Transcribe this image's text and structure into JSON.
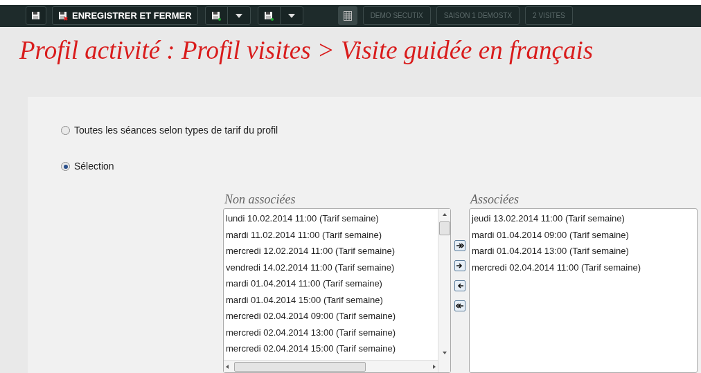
{
  "toolbar": {
    "save_close_label": "ENREGISTRER ET FERMER",
    "tabs": [
      {
        "label": "DEMO SECUTIX",
        "disabled": true
      },
      {
        "label": "SAISON 1 DEMOSTX",
        "disabled": true
      },
      {
        "label": "2 VISITES",
        "disabled": true
      }
    ]
  },
  "title": "Profil activité : Profil visites > Visite guidée en français",
  "options": [
    {
      "label": "Toutes les séances selon types de tarif du profil",
      "selected": false
    },
    {
      "label": "Sélection",
      "selected": true
    }
  ],
  "non_associees": {
    "label": "Non associées",
    "items": [
      "lundi 10.02.2014 11:00 (Tarif semaine)",
      "mardi 11.02.2014 11:00 (Tarif semaine)",
      "mercredi 12.02.2014 11:00 (Tarif semaine)",
      "vendredi 14.02.2014 11:00 (Tarif semaine)",
      "mardi 01.04.2014 11:00 (Tarif semaine)",
      "mardi 01.04.2014 15:00 (Tarif semaine)",
      "mercredi 02.04.2014 09:00 (Tarif semaine)",
      "mercredi 02.04.2014 13:00 (Tarif semaine)",
      "mercredi 02.04.2014 15:00 (Tarif semaine)"
    ]
  },
  "associees": {
    "label": "Associées",
    "items": [
      "jeudi 13.02.2014 11:00 (Tarif semaine)",
      "mardi 01.04.2014 09:00 (Tarif semaine)",
      "mardi 01.04.2014 13:00 (Tarif semaine)",
      "mercredi 02.04.2014 11:00 (Tarif semaine)"
    ]
  }
}
